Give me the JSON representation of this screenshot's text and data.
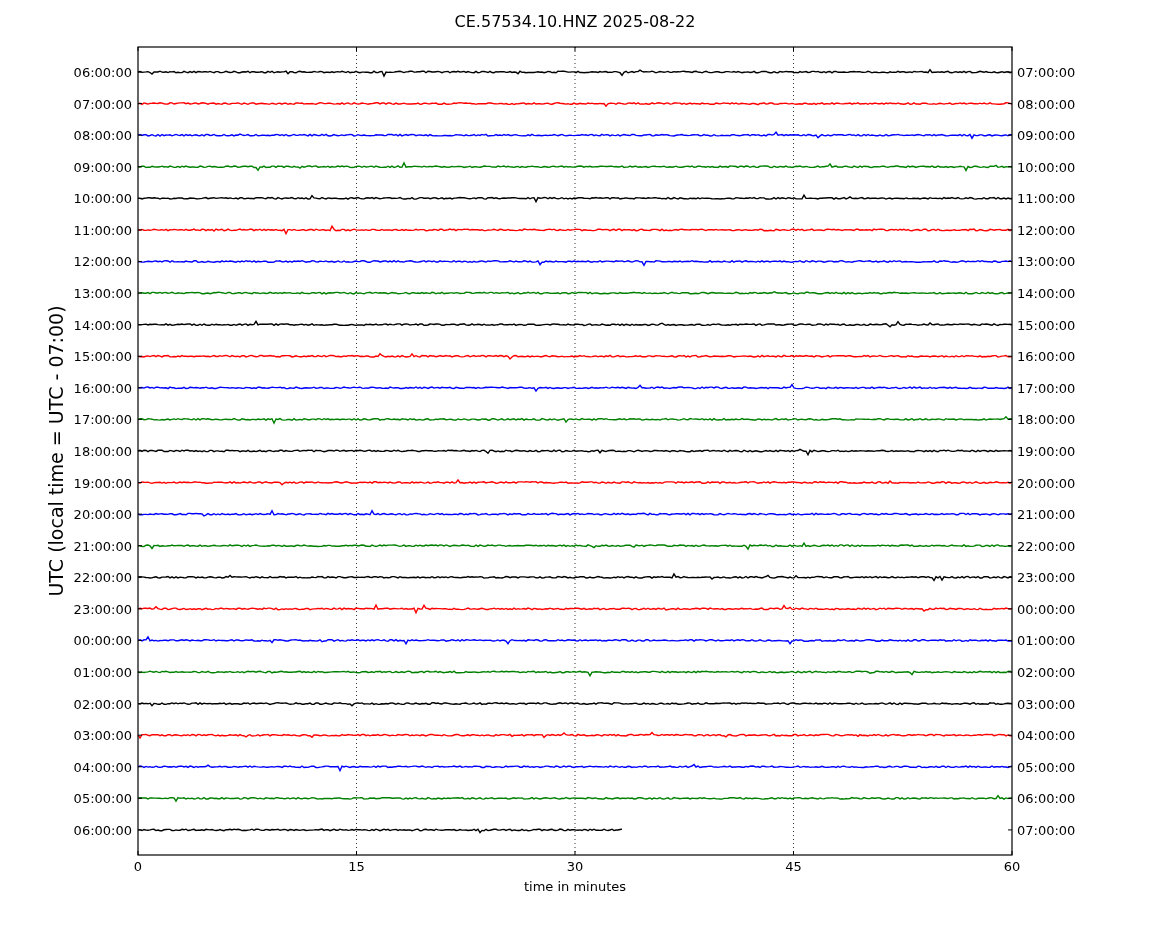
{
  "title": "CE.57534.10.HNZ 2025-08-22",
  "ylabel": "UTC (local time = UTC - 07:00)",
  "xlabel": "time in minutes",
  "xticks": [
    "0",
    "15",
    "30",
    "45",
    "60"
  ],
  "rows": [
    {
      "left": "06:00:00",
      "right": "07:00:00",
      "color": "#000000",
      "level": 1
    },
    {
      "left": "07:00:00",
      "right": "08:00:00",
      "color": "#ff0000",
      "level": 1
    },
    {
      "left": "08:00:00",
      "right": "09:00:00",
      "color": "#0000ff",
      "level": 1
    },
    {
      "left": "09:00:00",
      "right": "10:00:00",
      "color": "#008000",
      "level": 1
    },
    {
      "left": "10:00:00",
      "right": "11:00:00",
      "color": "#000000",
      "level": 1
    },
    {
      "left": "11:00:00",
      "right": "12:00:00",
      "color": "#ff0000",
      "level": 1
    },
    {
      "left": "12:00:00",
      "right": "13:00:00",
      "color": "#0000ff",
      "level": 1
    },
    {
      "left": "13:00:00",
      "right": "14:00:00",
      "color": "#008000",
      "level": 1
    },
    {
      "left": "14:00:00",
      "right": "15:00:00",
      "color": "#000000",
      "level": 1
    },
    {
      "left": "15:00:00",
      "right": "16:00:00",
      "color": "#ff0000",
      "level": 1
    },
    {
      "left": "16:00:00",
      "right": "17:00:00",
      "color": "#0000ff",
      "level": 1
    },
    {
      "left": "17:00:00",
      "right": "18:00:00",
      "color": "#008000",
      "level": 1
    },
    {
      "left": "18:00:00",
      "right": "19:00:00",
      "color": "#000000",
      "level": 1
    },
    {
      "left": "19:00:00",
      "right": "20:00:00",
      "color": "#ff0000",
      "level": 1
    },
    {
      "left": "20:00:00",
      "right": "21:00:00",
      "color": "#0000ff",
      "level": 1
    },
    {
      "left": "21:00:00",
      "right": "22:00:00",
      "color": "#008000",
      "level": 1
    },
    {
      "left": "22:00:00",
      "right": "23:00:00",
      "color": "#000000",
      "level": 1
    },
    {
      "left": "23:00:00",
      "right": "00:00:00",
      "color": "#ff0000",
      "level": 1
    },
    {
      "left": "00:00:00",
      "right": "01:00:00",
      "color": "#0000ff",
      "level": 1
    },
    {
      "left": "01:00:00",
      "right": "02:00:00",
      "color": "#008000",
      "level": 1
    },
    {
      "left": "02:00:00",
      "right": "03:00:00",
      "color": "#000000",
      "level": 1
    },
    {
      "left": "03:00:00",
      "right": "04:00:00",
      "color": "#ff0000",
      "level": 1
    },
    {
      "left": "04:00:00",
      "right": "05:00:00",
      "color": "#0000ff",
      "level": 1
    },
    {
      "left": "05:00:00",
      "right": "06:00:00",
      "color": "#008000",
      "level": 1
    },
    {
      "left": "06:00:00",
      "right": "07:00:00",
      "color": "#000000",
      "level": 0.555
    }
  ]
}
